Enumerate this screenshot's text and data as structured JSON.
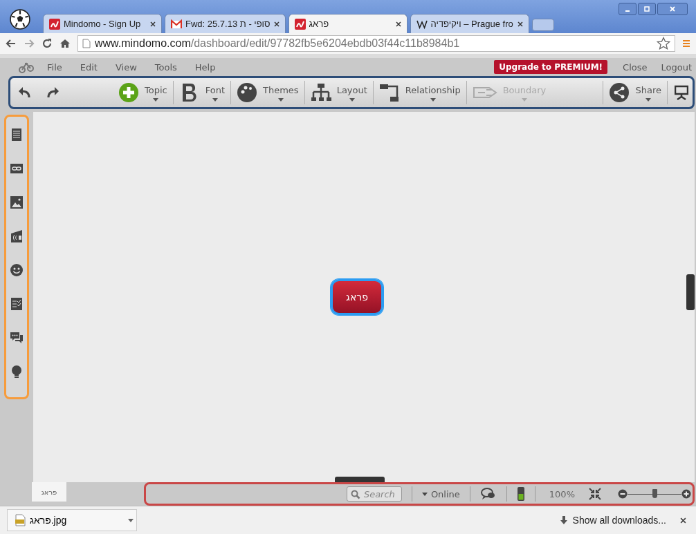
{
  "browser": {
    "tabs": [
      {
        "title": "Mindomo - Sign Up",
        "kind": "mindomo",
        "selected": false
      },
      {
        "title": "Fwd: 25.7.13 סופי - ת",
        "kind": "gmail",
        "selected": false
      },
      {
        "title": "פראג",
        "kind": "mindomo",
        "selected": true
      },
      {
        "title": "ויקיפדיה – Prague fro",
        "kind": "wiki",
        "selected": false
      }
    ],
    "url": {
      "domain": "www.mindomo.com",
      "path": "/dashboard/edit/97782fb5e6204ebdb03f44c11b8984b1"
    }
  },
  "menu": [
    "File",
    "Edit",
    "View",
    "Tools",
    "Help"
  ],
  "premium": "Upgrade to PREMIUM!",
  "account_links": [
    "Close",
    "Logout"
  ],
  "toolbar": [
    {
      "label": "Topic",
      "kind": "topic",
      "disabled": false
    },
    {
      "label": "Font",
      "kind": "font",
      "disabled": false
    },
    {
      "label": "Themes",
      "kind": "themes",
      "disabled": false
    },
    {
      "label": "Layout",
      "kind": "layout",
      "disabled": false
    },
    {
      "label": "Relationship",
      "kind": "relationship",
      "disabled": false
    },
    {
      "label": "Boundary",
      "kind": "boundary",
      "disabled": true
    },
    {
      "label": "Share",
      "kind": "share",
      "disabled": false
    }
  ],
  "node": {
    "label": "פראג",
    "selected": true
  },
  "sheet_tab": "פראג",
  "status": {
    "search_placeholder": "Search",
    "online": "Online",
    "zoom": "100%",
    "zoom_slider": {
      "level": 0.5
    }
  },
  "download": {
    "file": "פראג.jpg",
    "show_all": "Show all downloads..."
  }
}
